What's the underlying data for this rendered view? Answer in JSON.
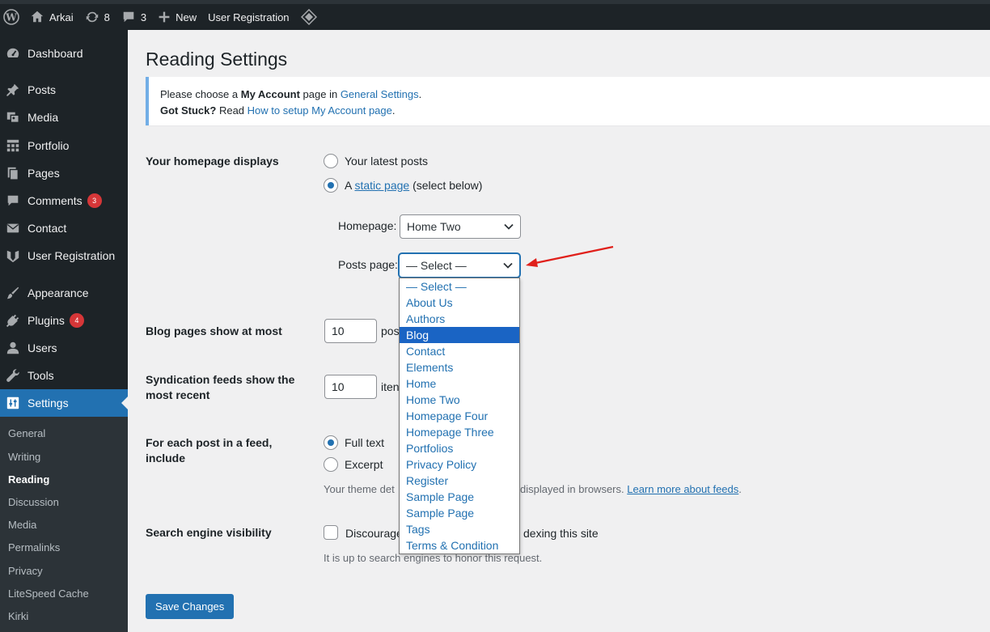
{
  "adminbar": {
    "site_name": "Arkai",
    "updates_count": "8",
    "comments_count": "3",
    "new_label": "New",
    "plugin_label": "User Registration"
  },
  "sidebar": {
    "items": [
      {
        "label": "Dashboard"
      },
      {
        "label": "Posts"
      },
      {
        "label": "Media"
      },
      {
        "label": "Portfolio"
      },
      {
        "label": "Pages"
      },
      {
        "label": "Comments",
        "count": "3"
      },
      {
        "label": "Contact"
      },
      {
        "label": "User Registration"
      },
      {
        "label": "Appearance"
      },
      {
        "label": "Plugins",
        "count": "4"
      },
      {
        "label": "Users"
      },
      {
        "label": "Tools"
      },
      {
        "label": "Settings"
      }
    ],
    "submenu": [
      "General",
      "Writing",
      "Reading",
      "Discussion",
      "Media",
      "Permalinks",
      "Privacy",
      "LiteSpeed Cache",
      "Kirki"
    ]
  },
  "page": {
    "title": "Reading Settings",
    "notice": {
      "line1_pre": "Please choose a ",
      "line1_bold": "My Account",
      "line1_mid": " page in ",
      "line1_link": "General Settings",
      "line1_end": ".",
      "line2_bold": "Got Stuck?",
      "line2_mid": " Read ",
      "line2_link": "How to setup My Account page",
      "line2_end": "."
    },
    "homepage_displays": {
      "label": "Your homepage displays",
      "option_latest": "Your latest posts",
      "option_static_pre": "A ",
      "option_static_link": "static page",
      "option_static_post": " (select below)",
      "homepage_label": "Homepage:",
      "homepage_value": "Home Two",
      "posts_page_label": "Posts page:",
      "posts_page_value": "— Select —"
    },
    "blog_pages": {
      "label": "Blog pages show at most",
      "value": "10",
      "suffix": "pos"
    },
    "syndication": {
      "label_line1": "Syndication feeds show the",
      "label_line2": "most recent",
      "value": "10",
      "suffix": "iten"
    },
    "feed_include": {
      "label": "For each post in a feed, include",
      "option_full": "Full text",
      "option_excerpt": "Excerpt",
      "desc_pre": "Your theme det",
      "desc_post": "displayed in browsers. ",
      "desc_link": "Learn more about feeds",
      "desc_end": "."
    },
    "search_visibility": {
      "label": "Search engine visibility",
      "checkbox_pre": "Discourage",
      "checkbox_post": "dexing this site",
      "desc_pre": "It is up to search engines to honor this request."
    },
    "save_label": "Save Changes"
  },
  "dropdown": {
    "highlighted_index": 3,
    "options": [
      "— Select —",
      "About Us",
      "Authors",
      "Blog",
      "Contact",
      "Elements",
      "Home",
      "Home Two",
      "Homepage Four",
      "Homepage Three",
      "Portfolios",
      "Privacy Policy",
      "Register",
      "Sample Page",
      "Sample Page",
      "Tags",
      "Terms & Condition"
    ]
  },
  "colors": {
    "adminbar_bg": "#1d2327",
    "accent": "#2271b1",
    "badge": "#d63638",
    "annotation_arrow": "#e0201b"
  },
  "icons": [
    "wordpress-icon",
    "home-icon",
    "updates-icon",
    "comment-icon",
    "plus-icon",
    "plugin-diamond-icon",
    "dashboard-icon",
    "pin-icon",
    "media-icon",
    "portfolio-icon",
    "pages-icon",
    "comments-icon",
    "mail-icon",
    "user-registration-icon",
    "brush-icon",
    "plug-icon",
    "users-icon",
    "wrench-icon",
    "settings-icon"
  ]
}
